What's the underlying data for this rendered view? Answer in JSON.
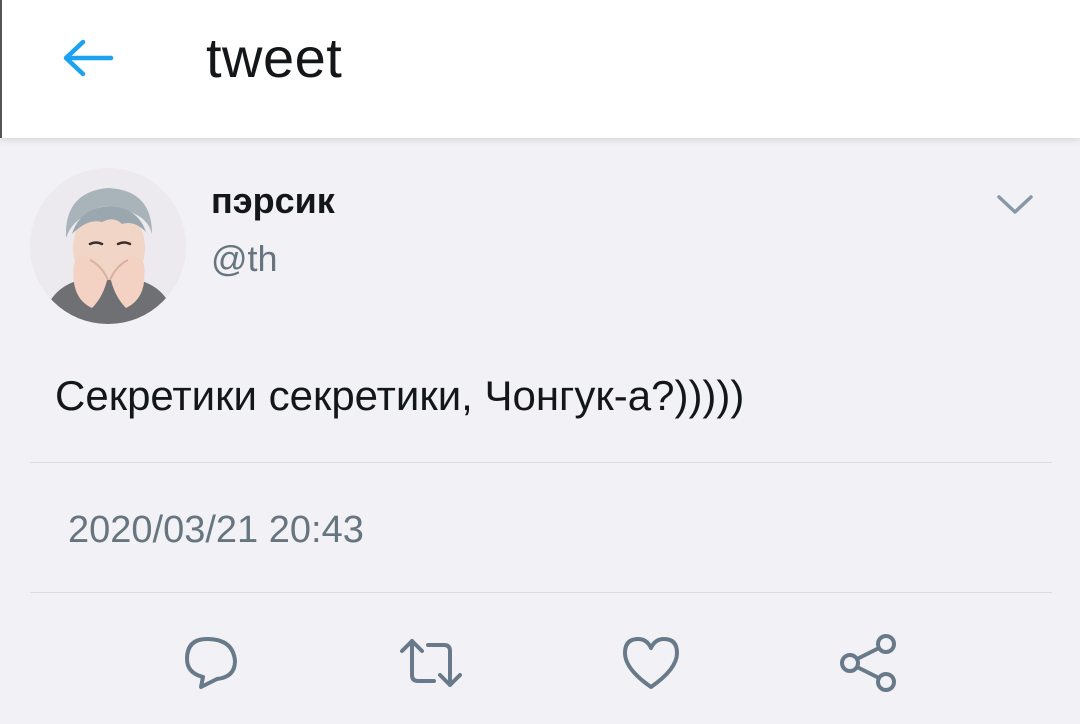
{
  "header": {
    "title": "tweet",
    "back_icon": "arrow-left-icon",
    "accent_color": "#1da1f2"
  },
  "tweet": {
    "display_name": "пэрсик",
    "handle": "@th",
    "text": "Секретики секретики, Чонгук-а?)))))",
    "timestamp": "2020/03/21 20:43",
    "menu_icon": "chevron-down-icon",
    "avatar": "avatar-photo"
  },
  "actions": [
    {
      "icon": "reply-icon"
    },
    {
      "icon": "retweet-icon"
    },
    {
      "icon": "like-icon"
    },
    {
      "icon": "share-icon"
    }
  ],
  "colors": {
    "background": "#f2f1f6",
    "text": "#14171a",
    "secondary_text": "#66757f",
    "icon": "#687a8a"
  }
}
